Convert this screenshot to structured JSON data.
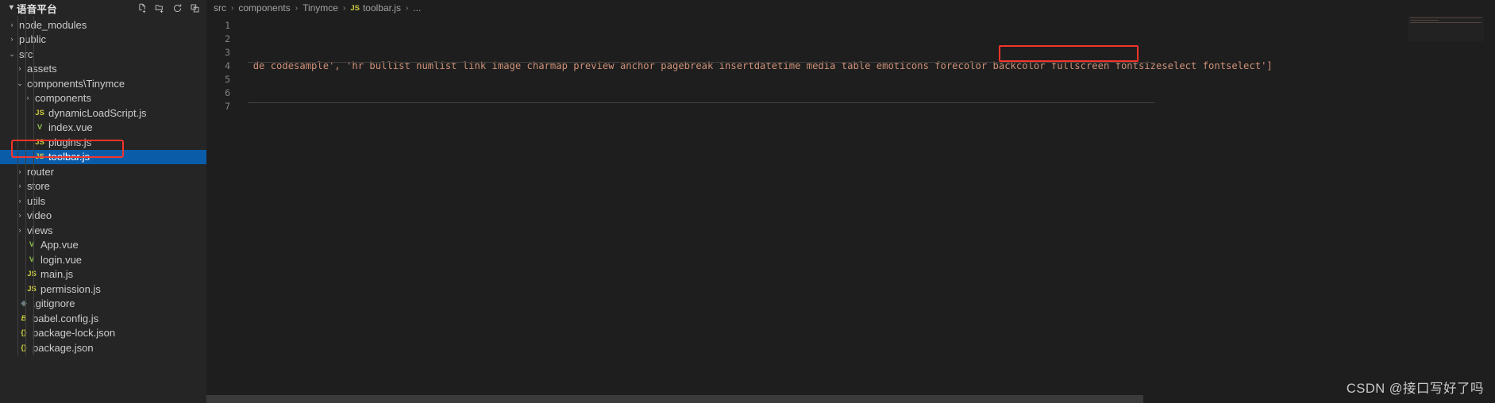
{
  "sidebar": {
    "header": {
      "title": "语音平台",
      "caret": "▾",
      "actions": [
        {
          "name": "new-file-icon",
          "glyph": "🗋"
        },
        {
          "name": "new-folder-icon",
          "glyph": "🗀"
        },
        {
          "name": "refresh-explorer-icon",
          "glyph": "⟳"
        },
        {
          "name": "collapse-folders-icon",
          "glyph": "⊟"
        }
      ]
    },
    "items": [
      {
        "label": "node_modules",
        "indent": 1,
        "arrow": "closed",
        "icon": "none",
        "selected": false
      },
      {
        "label": "public",
        "indent": 1,
        "arrow": "closed",
        "icon": "none",
        "selected": false
      },
      {
        "label": "src",
        "indent": 1,
        "arrow": "open",
        "icon": "none",
        "selected": false
      },
      {
        "label": "assets",
        "indent": 2,
        "arrow": "closed",
        "icon": "none",
        "selected": false
      },
      {
        "label": "components\\Tinymce",
        "indent": 2,
        "arrow": "open",
        "icon": "none",
        "selected": false
      },
      {
        "label": "components",
        "indent": 3,
        "arrow": "closed",
        "icon": "none",
        "selected": false
      },
      {
        "label": "dynamicLoadScript.js",
        "indent": 3,
        "arrow": "none",
        "icon": "js",
        "selected": false
      },
      {
        "label": "index.vue",
        "indent": 3,
        "arrow": "none",
        "icon": "vue",
        "selected": false
      },
      {
        "label": "plugins.js",
        "indent": 3,
        "arrow": "none",
        "icon": "js",
        "selected": false
      },
      {
        "label": "toolbar.js",
        "indent": 3,
        "arrow": "none",
        "icon": "js",
        "selected": true
      },
      {
        "label": "router",
        "indent": 2,
        "arrow": "closed",
        "icon": "none",
        "selected": false
      },
      {
        "label": "store",
        "indent": 2,
        "arrow": "closed",
        "icon": "none",
        "selected": false
      },
      {
        "label": "utils",
        "indent": 2,
        "arrow": "closed",
        "icon": "none",
        "selected": false
      },
      {
        "label": "video",
        "indent": 2,
        "arrow": "closed",
        "icon": "none",
        "selected": false
      },
      {
        "label": "views",
        "indent": 2,
        "arrow": "closed",
        "icon": "none",
        "selected": false
      },
      {
        "label": "App.vue",
        "indent": 2,
        "arrow": "none",
        "icon": "vue",
        "selected": false
      },
      {
        "label": "login.vue",
        "indent": 2,
        "arrow": "none",
        "icon": "vue",
        "selected": false
      },
      {
        "label": "main.js",
        "indent": 2,
        "arrow": "none",
        "icon": "js",
        "selected": false
      },
      {
        "label": "permission.js",
        "indent": 2,
        "arrow": "none",
        "icon": "js",
        "selected": false
      },
      {
        "label": ".gitignore",
        "indent": 1,
        "arrow": "none",
        "icon": "git",
        "selected": false
      },
      {
        "label": "babel.config.js",
        "indent": 1,
        "arrow": "none",
        "icon": "babel",
        "selected": false
      },
      {
        "label": "package-lock.json",
        "indent": 1,
        "arrow": "none",
        "icon": "json",
        "selected": false
      },
      {
        "label": "package.json",
        "indent": 1,
        "arrow": "none",
        "icon": "json",
        "selected": false
      }
    ]
  },
  "breadcrumb": {
    "items": [
      "src",
      "components",
      "Tinymce"
    ],
    "file": "toolbar.js",
    "file_badge": "JS",
    "more": "...",
    "separator": "›"
  },
  "editor": {
    "line_numbers": [
      "1",
      "2",
      "3",
      "4",
      "5",
      "6",
      "7"
    ],
    "lines": [
      "",
      "",
      "",
      "de codesample', 'hr bullist numlist link image charmap preview anchor pagebreak insertdatetime media table emoticons forecolor backcolor fullscreen fontsizeselect fontselect']",
      "",
      "",
      ""
    ],
    "highlighted_text": "fontsizeselect fontselect",
    "highlight_color": "#f4342a"
  },
  "watermark": "CSDN @接口写好了吗"
}
